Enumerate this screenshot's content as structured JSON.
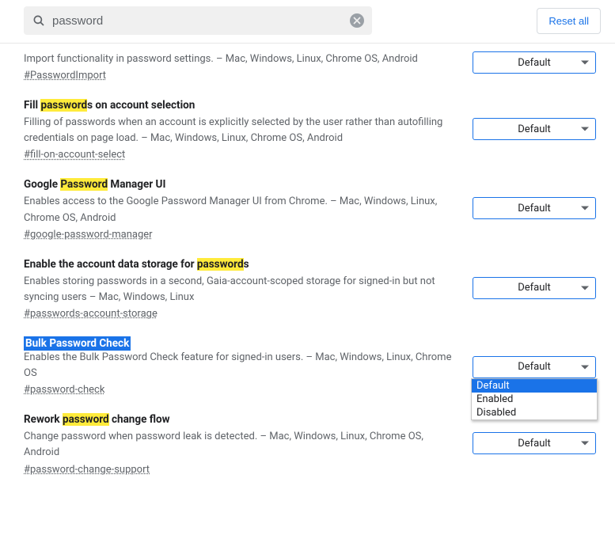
{
  "search": {
    "value": "password",
    "placeholder": "Search flags"
  },
  "reset_label": "Reset all",
  "dropdown_default": "Default",
  "dropdown_options": {
    "o0": "Default",
    "o1": "Enabled",
    "o2": "Disabled"
  },
  "flags": {
    "f0": {
      "desc_pre": "Import functionality in password settings. – Mac, Windows, Linux, Chrome OS, Android",
      "anchor": "#PasswordImport"
    },
    "f1": {
      "title_pre": "Fill ",
      "title_hl": "password",
      "title_post": "s on account selection",
      "desc": "Filling of passwords when an account is explicitly selected by the user rather than autofilling credentials on page load. – Mac, Windows, Linux, Chrome OS, Android",
      "anchor": "#fill-on-account-select"
    },
    "f2": {
      "title_pre": "Google ",
      "title_hl": "Password",
      "title_post": " Manager UI",
      "desc": "Enables access to the Google Password Manager UI from Chrome. – Mac, Windows, Linux, Chrome OS, Android",
      "anchor": "#google-password-manager"
    },
    "f3": {
      "title_pre": "Enable the account data storage for ",
      "title_hl": "password",
      "title_post": "s",
      "desc": "Enables storing passwords in a second, Gaia-account-scoped storage for signed-in but not syncing users – Mac, Windows, Linux",
      "anchor": "#passwords-account-storage"
    },
    "f4": {
      "title_full": "Bulk Password Check",
      "desc": "Enables the Bulk Password Check feature for signed-in users. – Mac, Windows, Linux, Chrome OS",
      "anchor": "#password-check"
    },
    "f5": {
      "title_pre": "Rework ",
      "title_hl": "password",
      "title_post": " change flow",
      "desc": "Change password when password leak is detected. – Mac, Windows, Linux, Chrome OS, Android",
      "anchor": "#password-change-support"
    }
  }
}
